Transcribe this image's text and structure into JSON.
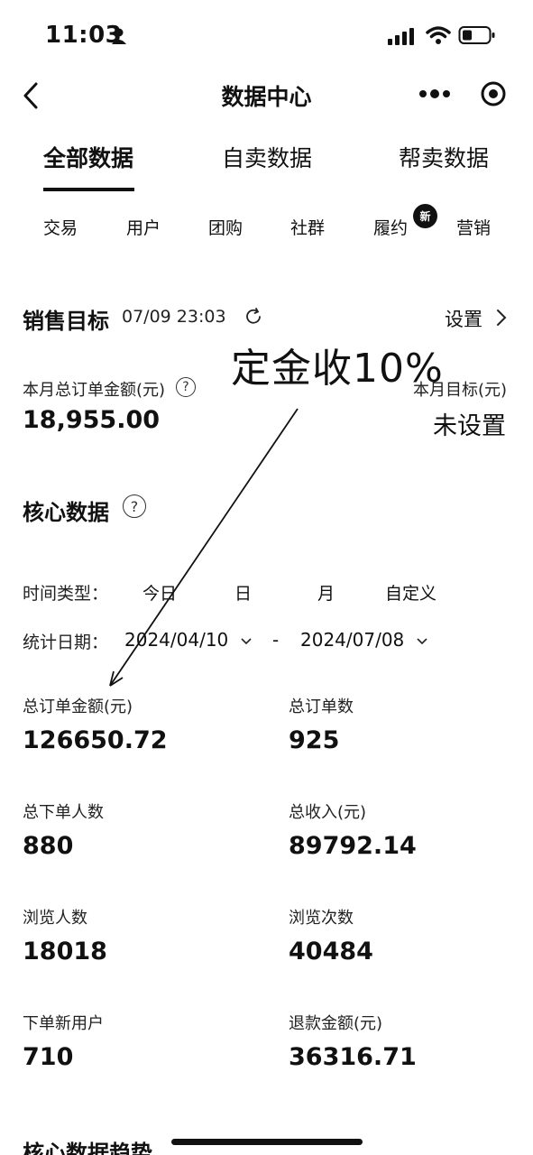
{
  "status_bar": {
    "time": "11:03"
  },
  "nav": {
    "title": "数据中心"
  },
  "tabs": [
    {
      "label": "全部数据",
      "active": true
    },
    {
      "label": "自卖数据",
      "active": false
    },
    {
      "label": "帮卖数据",
      "active": false
    }
  ],
  "subtabs": [
    "交易",
    "用户",
    "团购",
    "社群",
    "履约",
    "营销"
  ],
  "subtab_badge": "新",
  "sales_target": {
    "title": "销售目标",
    "timestamp": "07/09 23:03",
    "settings_label": "设置",
    "month_total_label": "本月总订单金额(元)",
    "month_total_value": "18,955.00",
    "month_target_label": "本月目标(元)",
    "month_target_value": "未设置"
  },
  "annotation": {
    "text": "定金收10%"
  },
  "core": {
    "title": "核心数据",
    "time_type_label": "时间类型：",
    "time_options": [
      "今日",
      "日",
      "月",
      "自定义"
    ],
    "date_label": "统计日期：",
    "date_start": "2024/04/10",
    "date_sep": "-",
    "date_end": "2024/07/08"
  },
  "metrics": [
    {
      "label": "总订单金额(元)",
      "value": "126650.72"
    },
    {
      "label": "总订单数",
      "value": "925"
    },
    {
      "label": "总下单人数",
      "value": "880"
    },
    {
      "label": "总收入(元)",
      "value": "89792.14"
    },
    {
      "label": "浏览人数",
      "value": "18018"
    },
    {
      "label": "浏览次数",
      "value": "40484"
    },
    {
      "label": "下单新用户",
      "value": "710"
    },
    {
      "label": "退款金额(元)",
      "value": "36316.71"
    }
  ],
  "trend": {
    "title": "核心数据趋势"
  }
}
